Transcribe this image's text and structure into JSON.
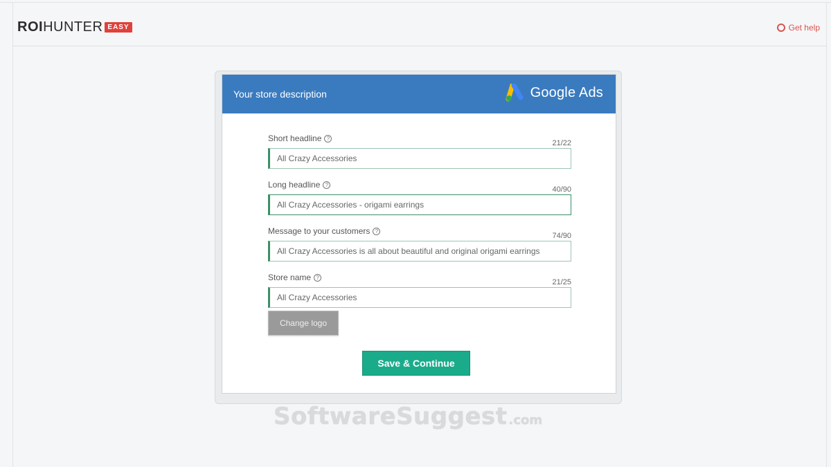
{
  "brand": {
    "name_bold": "ROI",
    "name_rest": "HUNTER",
    "badge": "EASY"
  },
  "header": {
    "get_help_label": "Get help"
  },
  "card": {
    "title": "Your store description",
    "partner_name": "Google Ads",
    "fields": [
      {
        "label": "Short headline",
        "counter": "21/22",
        "value": "All Crazy Accessories"
      },
      {
        "label": "Long headline",
        "counter": "40/90",
        "value": "All Crazy Accessories - origami earrings"
      },
      {
        "label": "Message to your customers",
        "counter": "74/90",
        "value": "All Crazy Accessories is all about beautiful and original origami earrings"
      },
      {
        "label": "Store name",
        "counter": "21/25",
        "value": "All Crazy Accessories"
      }
    ],
    "change_logo_label": "Change logo",
    "save_label": "Save & Continue"
  },
  "watermark": {
    "main": "SoftwareSuggest",
    "domain": ".com"
  },
  "colors": {
    "header_blue": "#3a7bbf",
    "save_green": "#1aab8b",
    "badge_red": "#e0413b",
    "input_accent": "#3b8f69"
  },
  "icons": [
    "help-icon",
    "info-icon",
    "google-ads-icon"
  ]
}
